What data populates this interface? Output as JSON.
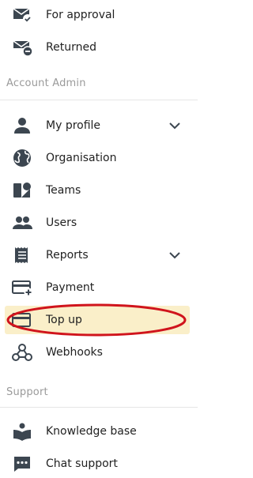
{
  "menu": {
    "top_items": [
      {
        "label": "For approval",
        "icon": "mail-check-icon"
      },
      {
        "label": "Returned",
        "icon": "mail-return-icon"
      }
    ],
    "account_admin": {
      "heading": "Account Admin",
      "items": [
        {
          "label": "My profile",
          "icon": "person-icon",
          "expandable": true
        },
        {
          "label": "Organisation",
          "icon": "globe-icon"
        },
        {
          "label": "Teams",
          "icon": "teams-icon"
        },
        {
          "label": "Users",
          "icon": "users-icon"
        },
        {
          "label": "Reports",
          "icon": "receipt-icon",
          "expandable": true
        },
        {
          "label": "Payment",
          "icon": "card-add-icon"
        },
        {
          "label": "Top up",
          "icon": "card-icon",
          "active": true
        },
        {
          "label": "Webhooks",
          "icon": "webhook-icon"
        }
      ]
    },
    "support": {
      "heading": "Support",
      "items": [
        {
          "label": "Knowledge base",
          "icon": "book-person-icon"
        },
        {
          "label": "Chat support",
          "icon": "chat-icon"
        }
      ]
    }
  },
  "colors": {
    "active_bg": "#faefc9",
    "annotation": "#d0141c",
    "icon": "#3c4650",
    "section_text": "#9a9a9a"
  }
}
